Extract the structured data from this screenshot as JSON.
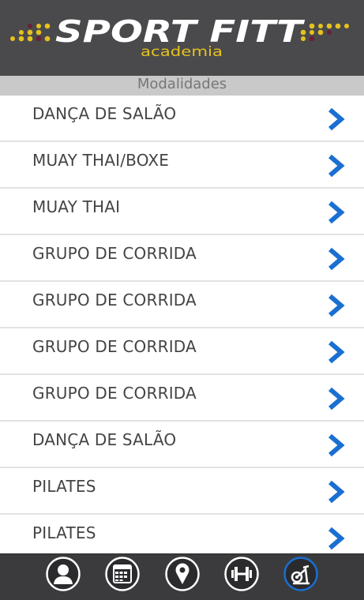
{
  "header": {
    "logo_title": "SPORT FITT",
    "logo_subtitle": "academia"
  },
  "subheader": {
    "title": "Modalidades"
  },
  "list": {
    "items": [
      {
        "label": "DANÇA DE SALÃO"
      },
      {
        "label": "MUAY THAI/BOXE"
      },
      {
        "label": "MUAY THAI"
      },
      {
        "label": "GRUPO DE CORRIDA"
      },
      {
        "label": "GRUPO DE CORRIDA"
      },
      {
        "label": "GRUPO DE CORRIDA"
      },
      {
        "label": "GRUPO DE CORRIDA"
      },
      {
        "label": "DANÇA DE SALÃO"
      },
      {
        "label": "PILATES"
      },
      {
        "label": "PILATES"
      }
    ],
    "chevron_icon": "chevron-right-icon",
    "chevron_color": "#1a6fd1"
  },
  "tabbar": {
    "tabs": [
      {
        "icon": "profile-icon",
        "active": false
      },
      {
        "icon": "calendar-icon",
        "active": false
      },
      {
        "icon": "location-pin-icon",
        "active": false
      },
      {
        "icon": "dumbbell-icon",
        "active": false
      },
      {
        "icon": "exercise-bike-icon",
        "active": true
      }
    ]
  },
  "colors": {
    "header_bg": "#4a4a4c",
    "logo_yellow": "#e6c21e",
    "logo_maroon": "#6b1f3a",
    "active_tab": "#1a6fd1"
  }
}
